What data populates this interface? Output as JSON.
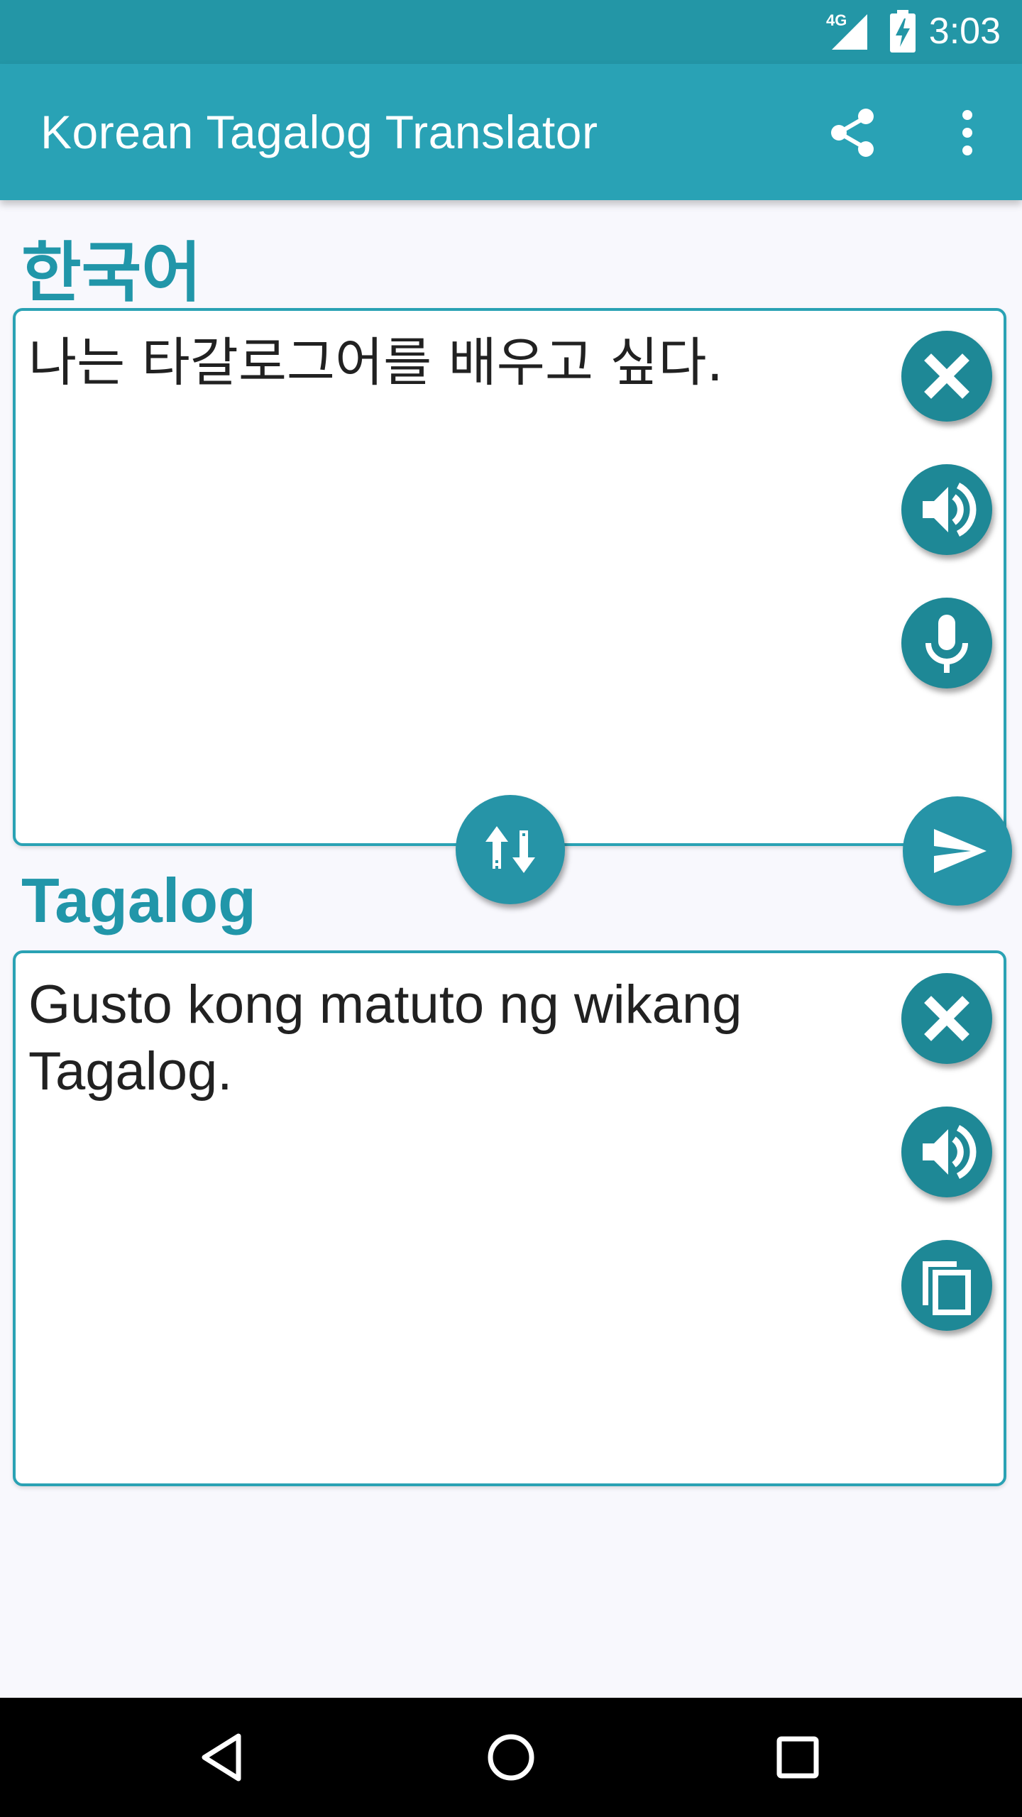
{
  "status_bar": {
    "network": "4G",
    "time": "3:03",
    "signal_icon": "signal-icon",
    "battery_icon": "battery-charging-icon"
  },
  "app_bar": {
    "title": "Korean Tagalog Translator",
    "share_icon": "share-icon",
    "more_icon": "more-vert-icon"
  },
  "source": {
    "language": "한국어",
    "text": "나는 타갈로그어를 배우고 싶다.",
    "buttons": [
      "clear-icon",
      "speaker-icon",
      "mic-icon"
    ]
  },
  "swap_icon": "swap-vertical-icon",
  "translate_icon": "send-icon",
  "target": {
    "language": "Tagalog",
    "text": "Gusto kong matuto ng wikang Tagalog.",
    "buttons": [
      "clear-icon",
      "speaker-icon",
      "copy-icon"
    ]
  },
  "nav_bar": {
    "back_icon": "back-icon",
    "home_icon": "home-icon",
    "recents_icon": "recents-icon"
  },
  "colors": {
    "primary": "#29a2b5",
    "primary_dark": "#2396a6",
    "accent_label": "#2196a9",
    "button": "#1e8896"
  }
}
